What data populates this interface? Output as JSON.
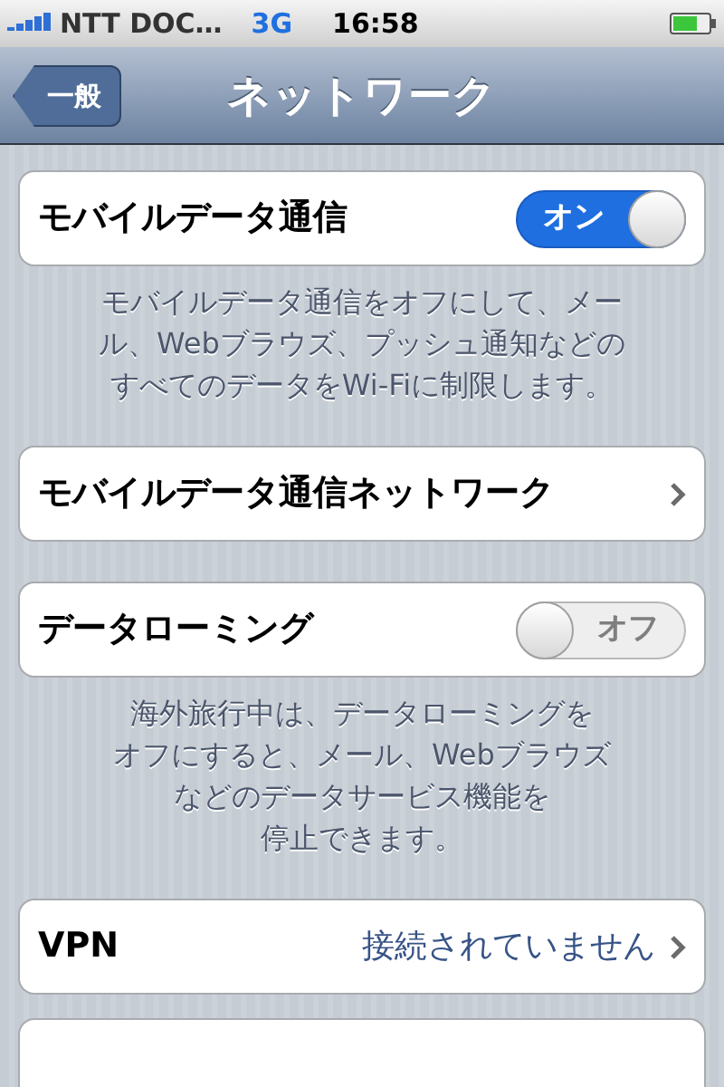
{
  "status_bar": {
    "carrier": "NTT DOC…",
    "network": "3G",
    "time": "16:58"
  },
  "nav_bar": {
    "back_button": "一般",
    "title": "ネットワーク"
  },
  "groups": [
    {
      "rows": [
        {
          "kind": "switch",
          "label": "モバイルデータ通信",
          "on": true,
          "switch_text": "オン"
        }
      ],
      "footer": [
        "モバイルデータ通信をオフにして、メー",
        "ル、Webブラウズ、プッシュ通知などの",
        "すべてのデータをWi-Fiに制限します。"
      ]
    },
    {
      "rows": [
        {
          "kind": "link",
          "label": "モバイルデータ通信ネットワーク"
        }
      ]
    },
    {
      "rows": [
        {
          "kind": "switch",
          "label": "データローミング",
          "on": false,
          "switch_text": "オフ"
        }
      ],
      "footer": [
        "海外旅行中は、データローミングを",
        "オフにすると、メール、Webブラウズ",
        "などのデータサービス機能を",
        "停止できます。"
      ]
    },
    {
      "rows": [
        {
          "kind": "link",
          "label": "VPN",
          "value": "接続されていません"
        }
      ]
    }
  ]
}
